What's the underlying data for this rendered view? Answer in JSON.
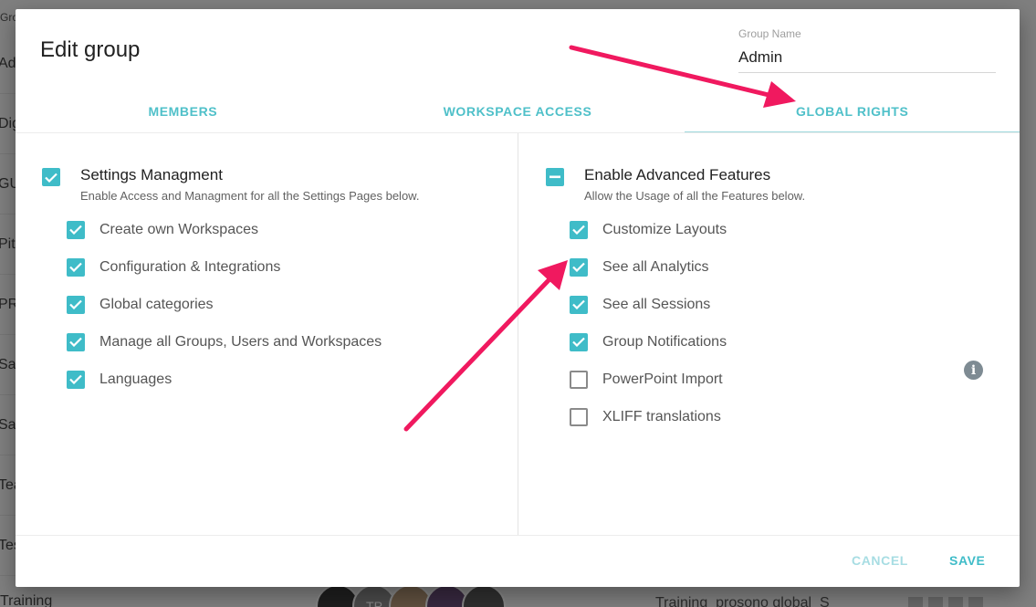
{
  "background": {
    "top_label": "Gro",
    "rows": [
      "Ad",
      "Dig",
      "GU",
      "Pit",
      "PR",
      "Sa",
      "Sa",
      "Tea",
      "Tes"
    ],
    "bottom_label": "Training",
    "avatar_initials": "TP",
    "right_text": "Training_prosono global_S"
  },
  "dialog": {
    "title": "Edit group",
    "group_name": {
      "label": "Group Name",
      "value": "Admin"
    },
    "tabs": [
      {
        "label": "MEMBERS",
        "active": false
      },
      {
        "label": "WORKSPACE ACCESS",
        "active": false
      },
      {
        "label": "GLOBAL RIGHTS",
        "active": true
      }
    ],
    "left_panel": {
      "title": "Settings Managment",
      "description": "Enable Access and Managment for all the Settings Pages below.",
      "state": "checked",
      "items": [
        {
          "label": "Create own Workspaces",
          "checked": true
        },
        {
          "label": "Configuration & Integrations",
          "checked": true
        },
        {
          "label": "Global categories",
          "checked": true
        },
        {
          "label": "Manage all Groups, Users and Workspaces",
          "checked": true
        },
        {
          "label": "Languages",
          "checked": true
        }
      ]
    },
    "right_panel": {
      "title": "Enable Advanced Features",
      "description": "Allow the Usage of all the Features below.",
      "state": "indeterminate",
      "items": [
        {
          "label": "Customize Layouts",
          "checked": true
        },
        {
          "label": "See all Analytics",
          "checked": true
        },
        {
          "label": "See all Sessions",
          "checked": true
        },
        {
          "label": "Group Notifications",
          "checked": true
        },
        {
          "label": "PowerPoint Import",
          "checked": false
        },
        {
          "label": "XLIFF translations",
          "checked": false
        }
      ],
      "info_icon": "info-icon"
    },
    "footer": {
      "cancel_label": "CANCEL",
      "save_label": "SAVE"
    }
  },
  "colors": {
    "accent": "#3fbcc8",
    "tab_text": "#4fc0c9",
    "cancel_text": "#a7dde3",
    "arrow": "#f0195f"
  }
}
